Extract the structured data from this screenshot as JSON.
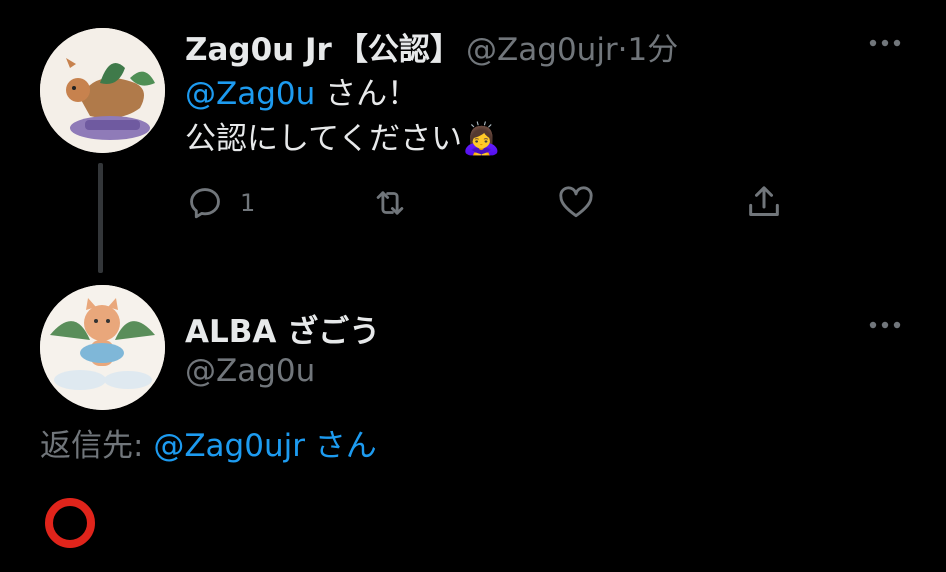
{
  "tweet": {
    "display_name": "Zag0u Jr",
    "badge": "【公認】",
    "handle": "@Zag0ujr",
    "separator": "·",
    "time": "1分",
    "mention": "@Zag0u",
    "line1_suffix": " さん！",
    "line2": "公認にしてください",
    "emoji": "🙇‍♀️",
    "reply_count": "1"
  },
  "reply": {
    "display_name": "ALBA ざごう",
    "handle": "@Zag0u",
    "replying_label": "返信先: ",
    "replying_handle": "@Zag0ujr",
    "replying_suffix": " さん",
    "body": "⭕"
  },
  "icons": {
    "reply": "reply-icon",
    "retweet": "retweet-icon",
    "like": "like-icon",
    "share": "share-icon",
    "more": "more-icon"
  },
  "colors": {
    "background": "#000000",
    "text": "#e7e9ea",
    "muted": "#71767b",
    "link": "#1d9bf0",
    "red_circle": "#e0241b"
  }
}
